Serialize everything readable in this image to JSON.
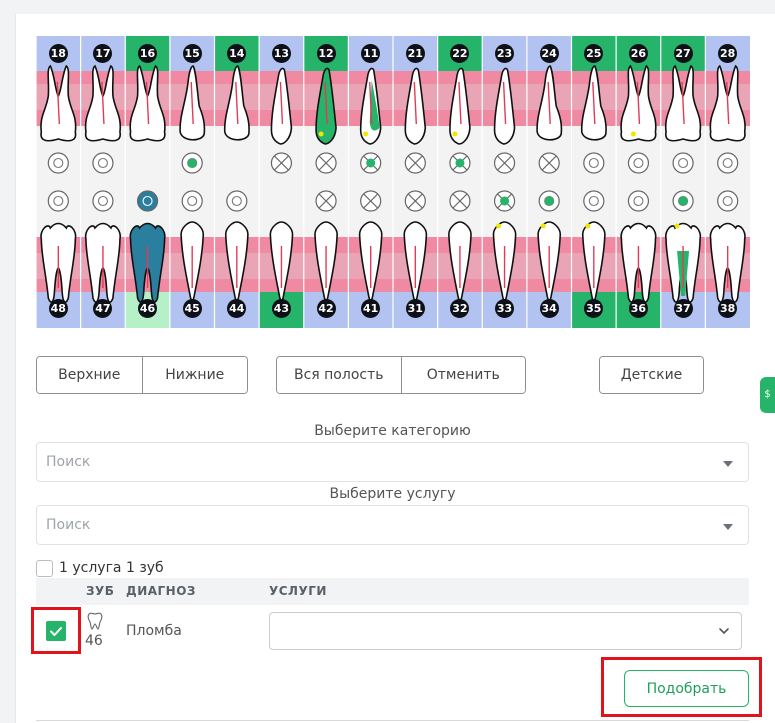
{
  "chart": {
    "upper_teeth": [
      "18",
      "17",
      "16",
      "15",
      "14",
      "13",
      "12",
      "11",
      "21",
      "22",
      "23",
      "24",
      "25",
      "26",
      "27",
      "28"
    ],
    "lower_teeth": [
      "48",
      "47",
      "46",
      "45",
      "44",
      "43",
      "42",
      "41",
      "31",
      "32",
      "33",
      "34",
      "35",
      "36",
      "37",
      "38"
    ],
    "colors": {
      "number_band_blue": "#b3c3f1",
      "number_band_green": "#26b36a",
      "number_band_light_green": "#b6f0c8",
      "pink_band": "#f08aa2",
      "mid_gray": "#f4f4f4",
      "tooth_highlight_teal": "#2a7f9e",
      "mark_yellow": "#f2e600"
    }
  },
  "buttons": {
    "upper": "Верхние",
    "lower": "Нижние",
    "whole": "Вся полость",
    "cancel": "Отменить",
    "kids": "Детские"
  },
  "category": {
    "label": "Выберите категорию",
    "placeholder": "Поиск"
  },
  "service": {
    "label": "Выберите услугу",
    "placeholder": "Поиск"
  },
  "one_service_label": "1 услуга 1 зуб",
  "table": {
    "col_tooth": "ЗУБ",
    "col_diagnosis": "ДИАГНОЗ",
    "col_services": "УСЛУГИ",
    "row": {
      "tooth": "46",
      "diagnosis": "Пломба",
      "checked": true
    }
  },
  "pick_button": "Подобрать",
  "side_tab": "$"
}
